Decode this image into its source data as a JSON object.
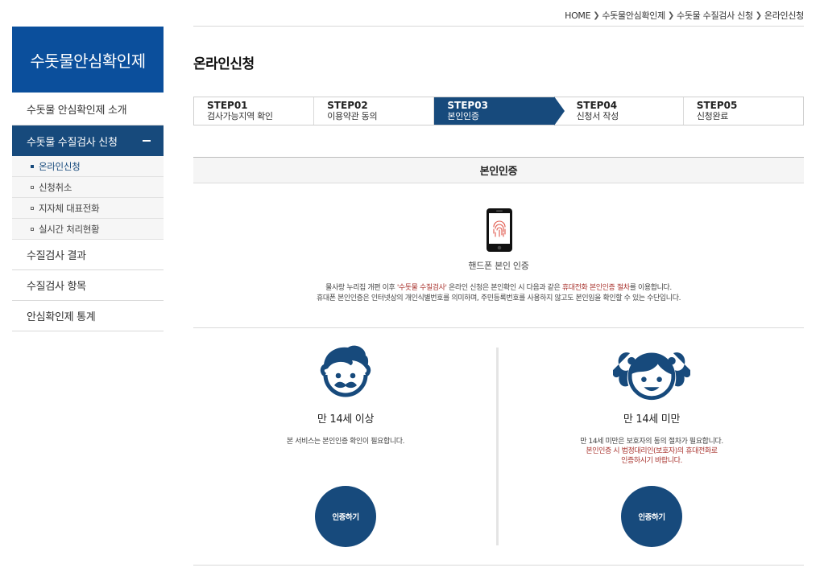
{
  "breadcrumb": [
    "HOME",
    "수돗물안심확인제",
    "수돗물 수질검사 신청",
    "온라인신청"
  ],
  "sidebar": {
    "title": "수돗물안심확인제",
    "items": [
      {
        "label": "수돗물 안심확인제 소개"
      },
      {
        "label": "수돗물 수질검사 신청"
      },
      {
        "label": "수질검사 결과"
      },
      {
        "label": "수질검사 항목"
      },
      {
        "label": "안심확인제 통계"
      }
    ],
    "subitems": [
      {
        "label": "온라인신청"
      },
      {
        "label": "신청취소"
      },
      {
        "label": "지자체 대표전화"
      },
      {
        "label": "실시간 처리현황"
      }
    ]
  },
  "page_title": "온라인신청",
  "steps": [
    {
      "num": "STEP01",
      "label": "검사가능지역 확인"
    },
    {
      "num": "STEP02",
      "label": "이용약관 동의"
    },
    {
      "num": "STEP03",
      "label": "본인인증"
    },
    {
      "num": "STEP04",
      "label": "신청서 작성"
    },
    {
      "num": "STEP05",
      "label": "신청완료"
    }
  ],
  "section_title": "본인인증",
  "phone_caption": "핸드폰 본인 인증",
  "desc": {
    "l1_a": "물사랑 누리집 개편 이후 ",
    "l1_b": "'수돗물 수질검사'",
    "l1_c": " 온라인 신청은 본인확인 시 다음과 같은 ",
    "l1_d": "휴대전화 본인인증 절차",
    "l1_e": "를 이용합니다.",
    "l2": "휴대폰 본인인증은 인터넷상의 개인식별번호를 의미하며, 주민등록번호를 사용하지 않고도 본인임을 확인할 수 있는 수단입니다."
  },
  "adult": {
    "title": "만 14세 이상",
    "desc": "본 서비스는 본인인증 확인이 필요합니다.",
    "button": "인증하기"
  },
  "minor": {
    "title": "만 14세 미만",
    "desc1": "만 14세 미만은 보호자의 동의 절차가 필요합니다.",
    "desc2": "본인인증 시 법정대리인(보호자)의 휴대전화로",
    "desc3": "인증하시기 바랍니다.",
    "button": "인증하기"
  },
  "colors": {
    "primary": "#174a7c",
    "brand": "#0b4f9c",
    "accent_red": "#a8322d",
    "fingerprint": "#e0574a"
  }
}
